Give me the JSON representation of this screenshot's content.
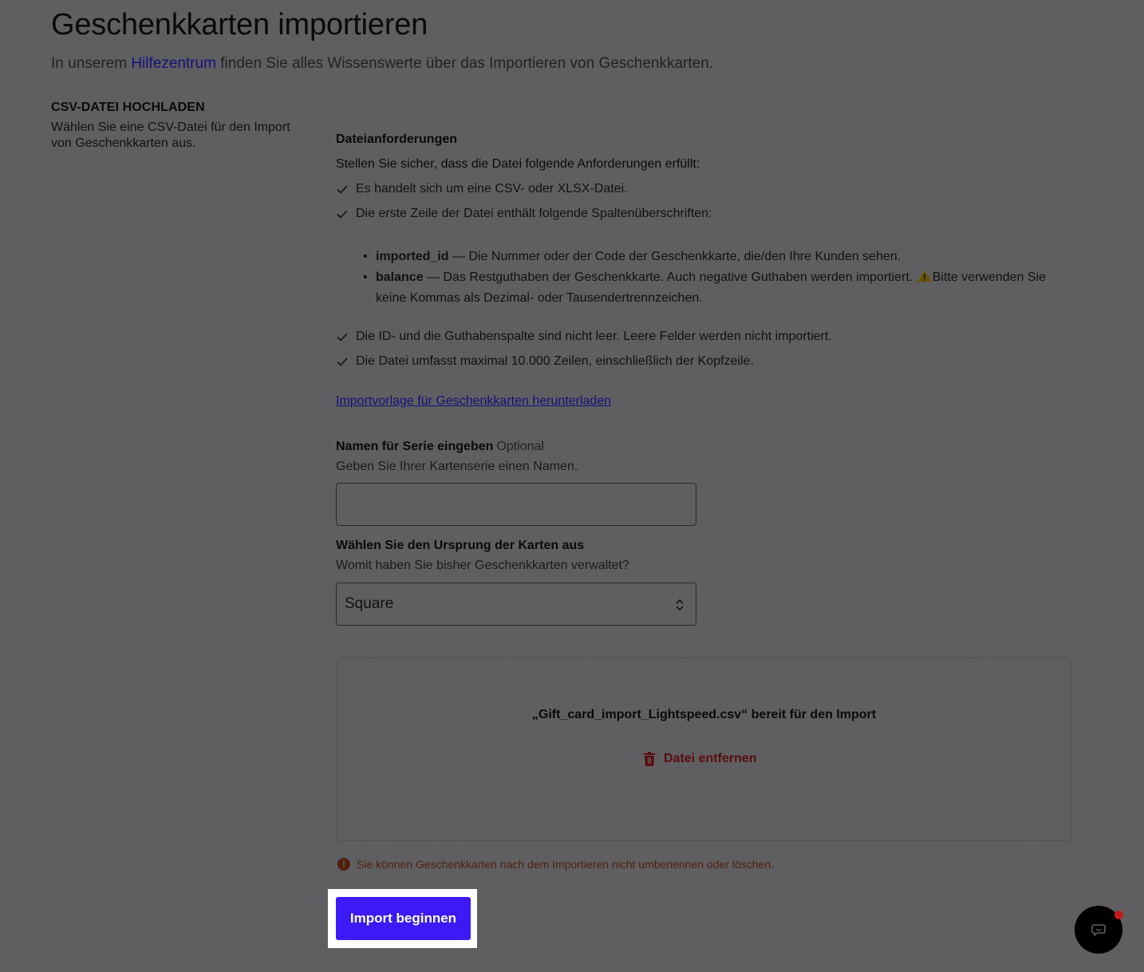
{
  "header": {
    "title": "Geschenkkarten importieren",
    "subtitle_before": "In unserem ",
    "subtitle_link": "Hilfezentrum",
    "subtitle_after": " finden Sie alles Wissenswerte über das Importieren von Geschenkkarten."
  },
  "section": {
    "heading": "CSV-DATEI HOCHLADEN",
    "description": "Wählen Sie eine CSV-Datei für den Import von Geschenkkarten aus."
  },
  "requirements": {
    "title": "Dateianforderungen",
    "intro": "Stellen Sie sicher, dass die Datei folgende Anforderungen erfüllt:",
    "check_1": "Es handelt sich um eine CSV- oder XLSX-Datei.",
    "check_2": "Die erste Zeile der Datei enthält folgende Spaltenüberschriften:",
    "column_1_name": "imported_id",
    "column_1_desc": " — Die Nummer oder der Code der Geschenkkarte, die/den Ihre Kunden sehen.",
    "column_2_name": "balance",
    "column_2_desc": " — Das Restguthaben der Geschenkkarte. Auch negative Guthaben werden importiert. ",
    "column_2_warning": "Bitte verwenden Sie keine Kommas als Dezimal- oder Tausendertrennzeichen.",
    "check_3": "Die ID- und die Guthabenspalte sind nicht leer. Leere Felder werden nicht importiert.",
    "check_4": "Die Datei umfasst maximal 10.000 Zeilen, einschließlich der Kopfzeile.",
    "template_link": "Importvorlage für Geschenkkarten herunterladen"
  },
  "series_name": {
    "label": "Namen für Serie eingeben",
    "optional": "Optional",
    "help": "Geben Sie Ihrer Kartenserie einen Namen.",
    "value": ""
  },
  "origin": {
    "label": "Wählen Sie den Ursprung der Karten aus",
    "help": "Womit haben Sie bisher Geschenkkarten verwaltet?",
    "selected": "Square"
  },
  "upload": {
    "ready_text": "„Gift_card_import_Lightspeed.csv“ bereit für den Import",
    "remove_label": "Datei entfernen"
  },
  "notice": "Sie können Geschenkkarten nach dem Importieren nicht umbenennen oder löschen.",
  "submit_label": "Import beginnen",
  "colors": {
    "primary": "#3b1af5",
    "link": "#16107a",
    "danger": "#5a0c0c",
    "chat_badge": "#c41b1b"
  }
}
